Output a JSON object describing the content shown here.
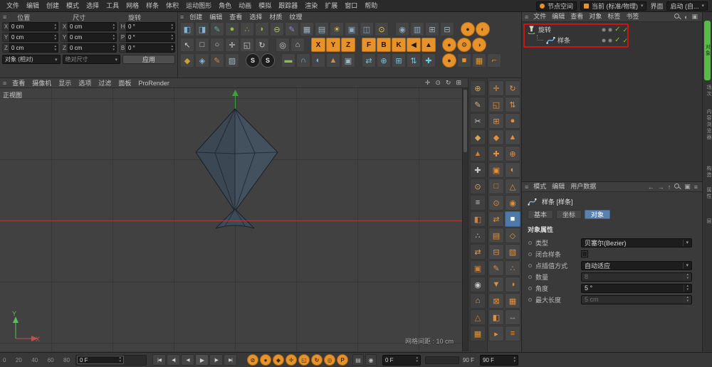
{
  "colors": {
    "accent_orange": "#e8922a",
    "axis_red": "#aa4038",
    "axis_green": "#3f9e42",
    "enable_check_green": "#82c91e",
    "active_tab_blue": "#5b82ad",
    "annotation_red": "#cc1414",
    "side_tab_active_green": "#56bd43"
  },
  "menubar": {
    "items": [
      "文件",
      "编辑",
      "创建",
      "模式",
      "选择",
      "工具",
      "网格",
      "样条",
      "体积",
      "运动图形",
      "角色",
      "动画",
      "模拟",
      "跟踪器",
      "渲染",
      "扩展",
      "窗口",
      "帮助"
    ],
    "node_space": "节点空间",
    "render_space": "当前 (标准/物理)",
    "interface_label": "界面",
    "layout_preset": "启动 (自..."
  },
  "material_menus": [
    "创建",
    "编辑",
    "查看",
    "选择",
    "材质",
    "纹理"
  ],
  "coord_panel": {
    "columns": [
      {
        "title": "位置",
        "fields": [
          {
            "label": "X",
            "value": "0 cm"
          },
          {
            "label": "Y",
            "value": "0 cm"
          },
          {
            "label": "Z",
            "value": "0 cm"
          }
        ]
      },
      {
        "title": "尺寸",
        "fields": [
          {
            "label": "X",
            "value": "0 cm"
          },
          {
            "label": "Y",
            "value": "0 cm"
          },
          {
            "label": "Z",
            "value": "0 cm"
          }
        ]
      },
      {
        "title": "旋转",
        "fields": [
          {
            "label": "H",
            "value": "0 °"
          },
          {
            "label": "P",
            "value": "0 °"
          },
          {
            "label": "B",
            "value": "0 °"
          }
        ]
      }
    ],
    "mode_select": "对象 (相对)",
    "size_select": "绝对尺寸",
    "apply_label": "应用"
  },
  "toolbar": {
    "rows": [
      [
        {
          "n": "add-cube-icon",
          "g": "◧",
          "c": "#7fb3da"
        },
        {
          "n": "edit-cube-icon",
          "g": "◨",
          "c": "#7fb3da"
        },
        {
          "n": "pen-teal-icon",
          "g": "✎",
          "c": "#52b8a8"
        },
        {
          "n": "sphere-tool-icon",
          "g": "●",
          "c": "#8cbf45"
        },
        {
          "n": "cluster-tool-icon",
          "g": "∴",
          "c": "#8cbf45"
        },
        {
          "n": "capsule-tool-icon",
          "g": "◗",
          "c": "#8cbf45"
        },
        {
          "n": "pill-tool-icon",
          "g": "⊖",
          "c": "#a9cf6a"
        },
        {
          "n": "spline-pen-icon",
          "g": "✎",
          "c": "#9b86c9"
        },
        {
          "n": "grid-panel-icon",
          "g": "▦",
          "c": "#9fb4bf"
        },
        {
          "n": "list-panel-icon",
          "g": "▤",
          "c": "#9fb4bf"
        },
        {
          "n": "light-icon",
          "g": "☀",
          "c": "#e5c654"
        },
        {
          "n": "screen-icon",
          "g": "▣",
          "c": "#8fa8bf"
        },
        {
          "n": "monitor-icon",
          "g": "◫",
          "c": "#8fa8bf"
        },
        {
          "n": "target-light-icon",
          "g": "⊙",
          "c": "#e5c654"
        },
        {
          "t": "gap"
        },
        {
          "n": "camera-icon",
          "g": "◉",
          "c": "#8fa8bf"
        },
        {
          "n": "film-icon",
          "g": "▥",
          "c": "#8fa8bf"
        },
        {
          "n": "window-tile-icon",
          "g": "⊞",
          "c": "#9fb4bf"
        },
        {
          "n": "window-split-icon",
          "g": "⊟",
          "c": "#9fb4bf"
        },
        {
          "t": "gap"
        },
        {
          "n": "render-view-button",
          "g": "●",
          "t": "circle"
        },
        {
          "n": "render-region-button",
          "g": "◐",
          "t": "circle"
        }
      ],
      [
        {
          "n": "cursor-icon",
          "g": "↖",
          "c": "#cccccc"
        },
        {
          "n": "box-select-icon",
          "g": "□",
          "c": "#cccccc"
        },
        {
          "n": "live-select-icon",
          "g": "○",
          "c": "#cccccc"
        },
        {
          "n": "move-tool-icon",
          "g": "✛",
          "c": "#cccccc"
        },
        {
          "n": "scale-tool-icon",
          "g": "◱",
          "c": "#cccccc"
        },
        {
          "n": "rotate-tool-icon",
          "g": "↻",
          "c": "#cccccc"
        },
        {
          "t": "gap"
        },
        {
          "n": "last-tool-icon",
          "g": "◎",
          "c": "#cccccc"
        },
        {
          "n": "coord-system-icon",
          "g": "⌂",
          "c": "#cccccc"
        },
        {
          "t": "gap"
        },
        {
          "n": "x-axis-lock-button",
          "g": "X",
          "t": "letter"
        },
        {
          "n": "y-axis-lock-button",
          "g": "Y",
          "t": "letter"
        },
        {
          "n": "z-axis-lock-button",
          "g": "Z",
          "t": "letter"
        },
        {
          "t": "gap"
        },
        {
          "n": "f-button",
          "g": "F",
          "t": "letter"
        },
        {
          "n": "b-button",
          "g": "B",
          "t": "letter"
        },
        {
          "n": "k-button",
          "g": "K",
          "t": "letter"
        },
        {
          "n": "arrow-left-button",
          "g": "◀",
          "t": "letter"
        },
        {
          "n": "arrow-up-button",
          "g": "▲",
          "t": "letter"
        },
        {
          "t": "gap"
        },
        {
          "n": "render-active-button",
          "g": "●",
          "t": "circle"
        },
        {
          "n": "render-settings-button",
          "g": "⚙",
          "t": "circle"
        },
        {
          "n": "render-queue-button",
          "g": "◑",
          "t": "circle"
        }
      ],
      [
        {
          "n": "material-icon",
          "g": "◆",
          "c": "#c9a227"
        },
        {
          "n": "shader-ball-icon",
          "g": "◈",
          "c": "#7fb3da"
        },
        {
          "n": "paint-icon",
          "g": "✎",
          "c": "#d08a4a"
        },
        {
          "n": "uv-grid-icon",
          "g": "▨",
          "c": "#9fb4bf"
        },
        {
          "t": "gap"
        },
        {
          "n": "material-s-badge",
          "g": "S",
          "t": "sbadge"
        },
        {
          "n": "shader-s-badge",
          "g": "S",
          "t": "sbadge"
        },
        {
          "t": "gap"
        },
        {
          "n": "floor-icon",
          "g": "▬",
          "c": "#8cbf45"
        },
        {
          "n": "sky-icon",
          "g": "∩",
          "c": "#7fb3da"
        },
        {
          "n": "environment-icon",
          "g": "◐",
          "c": "#7fb3da"
        },
        {
          "n": "stage-icon",
          "g": "▲",
          "c": "#d08a4a"
        },
        {
          "n": "camera-tool-icon",
          "g": "▣",
          "c": "#9fb4bf"
        },
        {
          "t": "gap"
        },
        {
          "n": "array-generator-icon",
          "g": "⇄",
          "c": "#6ec6d8"
        },
        {
          "n": "boole-generator-icon",
          "g": "⊕",
          "c": "#6ec6d8"
        },
        {
          "n": "instance-generator-icon",
          "g": "⊞",
          "c": "#6ec6d8"
        },
        {
          "n": "symmetry-generator-icon",
          "g": "⇅",
          "c": "#6ec6d8"
        },
        {
          "n": "add-generator-icon",
          "g": "✚",
          "c": "#6ec6d8"
        },
        {
          "t": "gap"
        },
        {
          "n": "record-dot-button",
          "g": "●",
          "t": "circle"
        },
        {
          "n": "cube-solid-icon",
          "g": "■",
          "c": "#e8922a"
        },
        {
          "n": "grid-orange-icon",
          "g": "▦",
          "c": "#e8922a"
        },
        {
          "n": "corner-orange-icon",
          "g": "⌐",
          "c": "#e8922a"
        }
      ]
    ]
  },
  "right_tool_column": [
    {
      "n": "navigate-icon",
      "g": "⊕",
      "c": "#d8a45a"
    },
    {
      "n": "pen-orange-icon",
      "g": "✎",
      "c": "#d8b08a"
    },
    {
      "n": "knife-icon",
      "g": "✂",
      "c": "#c8c8c8"
    },
    {
      "n": "gem-icon",
      "g": "◆",
      "c": "#d8a45a"
    },
    {
      "n": "cone-icon",
      "g": "▲",
      "c": "#c98040"
    },
    {
      "n": "add-point-icon",
      "g": "✚",
      "c": "#c8c8c8"
    },
    {
      "n": "target-icon",
      "g": "⊙",
      "c": "#d8a45a"
    },
    {
      "n": "layers-icon",
      "g": "≡",
      "c": "#c8c8c8"
    },
    {
      "n": "half-shade-icon",
      "g": "◧",
      "c": "#c98040"
    },
    {
      "n": "points-icon",
      "g": "∴",
      "c": "#c8c8c8"
    },
    {
      "n": "swap-icon",
      "g": "⇄",
      "c": "#d8a45a"
    },
    {
      "n": "frame-icon",
      "g": "▣",
      "c": "#c98040"
    },
    {
      "n": "ring-icon",
      "g": "◉",
      "c": "#c8c8c8"
    },
    {
      "n": "axis-home-icon",
      "g": "⌂",
      "c": "#d8a45a"
    },
    {
      "n": "triangle-icon",
      "g": "△",
      "c": "#c98040"
    },
    {
      "n": "grid-tool-icon",
      "g": "▦",
      "c": "#e8922a"
    }
  ],
  "right_dock": {
    "selected_index": 17,
    "glyphs": [
      "✛",
      "↻",
      "◱",
      "⇅",
      "⊞",
      "●",
      "◆",
      "▲",
      "✚",
      "⊕",
      "▣",
      "◐",
      "□",
      "△",
      "⊙",
      "◉",
      "⇄",
      "■",
      "▤",
      "◇",
      "⊟",
      "▧",
      "✎",
      "∴",
      "▼",
      "◑",
      "⊠",
      "▦",
      "◧",
      "↔",
      "▸",
      "≡"
    ]
  },
  "viewport": {
    "menus": [
      "查看",
      "摄像机",
      "显示",
      "选项",
      "过滤",
      "面板",
      "ProRender"
    ],
    "corner_icons": [
      {
        "n": "pan-view-icon",
        "g": "✛"
      },
      {
        "n": "zoom-view-icon",
        "g": "⊙"
      },
      {
        "n": "rotate-view-icon",
        "g": "↻"
      },
      {
        "n": "toggle-view-icon",
        "g": "⊞"
      }
    ],
    "view_label": "正视图",
    "grid_spacing": "网格间距 : 10 cm",
    "axis_labels": {
      "x": "X",
      "y": "Y"
    }
  },
  "object_manager": {
    "menus": [
      "文件",
      "编辑",
      "查看",
      "对象",
      "标签",
      "书签"
    ],
    "header_icons": [
      {
        "n": "search-icon",
        "g": "search"
      },
      {
        "n": "filter-icon",
        "g": "◐"
      },
      {
        "n": "layer-browser-icon",
        "g": "▣"
      }
    ],
    "items": [
      {
        "name": "旋转",
        "icon": "lathe-icon",
        "depth": 0
      },
      {
        "name": "样条",
        "icon": "spline-icon",
        "depth": 1
      }
    ]
  },
  "side_tabs": {
    "top_active": "对象",
    "top": [
      "场次",
      "内容浏览器",
      "构造"
    ],
    "bottom": [
      "属性",
      "层"
    ]
  },
  "attributes": {
    "menus": [
      "模式",
      "编辑",
      "用户数据"
    ],
    "header_icons": [
      {
        "n": "history-back-icon",
        "g": "←"
      },
      {
        "n": "history-forward-icon",
        "g": "→"
      },
      {
        "n": "parent-object-icon",
        "g": "↑"
      },
      {
        "n": "search-icon",
        "g": "search"
      },
      {
        "n": "lock-icon",
        "g": "▣"
      },
      {
        "n": "panel-menu-icon",
        "g": "≡"
      }
    ],
    "object_title": "样条 [样条]",
    "tabs": [
      "基本",
      "坐标",
      "对象"
    ],
    "active_tab": "对象",
    "section": "对象属性",
    "rows": [
      {
        "label": "类型",
        "value": "贝塞尔(Bezier)",
        "control": "select",
        "enabled": true
      },
      {
        "label": "闭合样条",
        "value": "",
        "control": "checkbox",
        "enabled": true,
        "checked": false
      },
      {
        "label": "点插值方式",
        "value": "自动适应",
        "control": "select",
        "enabled": true
      },
      {
        "label": "数量",
        "value": "8",
        "control": "number",
        "enabled": false
      },
      {
        "label": "角度",
        "value": "5 °",
        "control": "number",
        "enabled": true
      },
      {
        "label": "最大长度",
        "value": "5 cm",
        "control": "number",
        "enabled": false
      }
    ]
  },
  "timeline": {
    "ticks": [
      "0",
      "20",
      "40",
      "60",
      "80"
    ],
    "slider_value": "0 F",
    "transport": [
      {
        "n": "goto-start-button",
        "g": "|◀"
      },
      {
        "n": "prev-key-button",
        "g": "◀|"
      },
      {
        "n": "prev-frame-button",
        "g": "◀"
      },
      {
        "n": "play-button",
        "g": "▶"
      },
      {
        "n": "next-frame-button",
        "g": "|▶"
      },
      {
        "n": "goto-end-button",
        "g": "▶|"
      }
    ],
    "record_buttons": [
      {
        "n": "record-active-objects-button",
        "g": "⊘"
      },
      {
        "n": "autokey-button",
        "g": "●"
      },
      {
        "n": "keyframe-selection-button",
        "g": "◆"
      },
      {
        "n": "record-position-button",
        "g": "✛"
      },
      {
        "n": "record-scale-button",
        "g": "◱"
      },
      {
        "n": "record-rotation-button",
        "g": "↻"
      },
      {
        "n": "record-parameter-button",
        "g": "◎"
      },
      {
        "n": "record-pla-button",
        "g": "P"
      }
    ],
    "aux_buttons": [
      {
        "n": "keyframe-mode-button",
        "g": "▤"
      },
      {
        "n": "point-level-button",
        "g": "◉"
      }
    ],
    "current_field": "0 F",
    "end_label": "90 F",
    "end_field": "90 F"
  }
}
